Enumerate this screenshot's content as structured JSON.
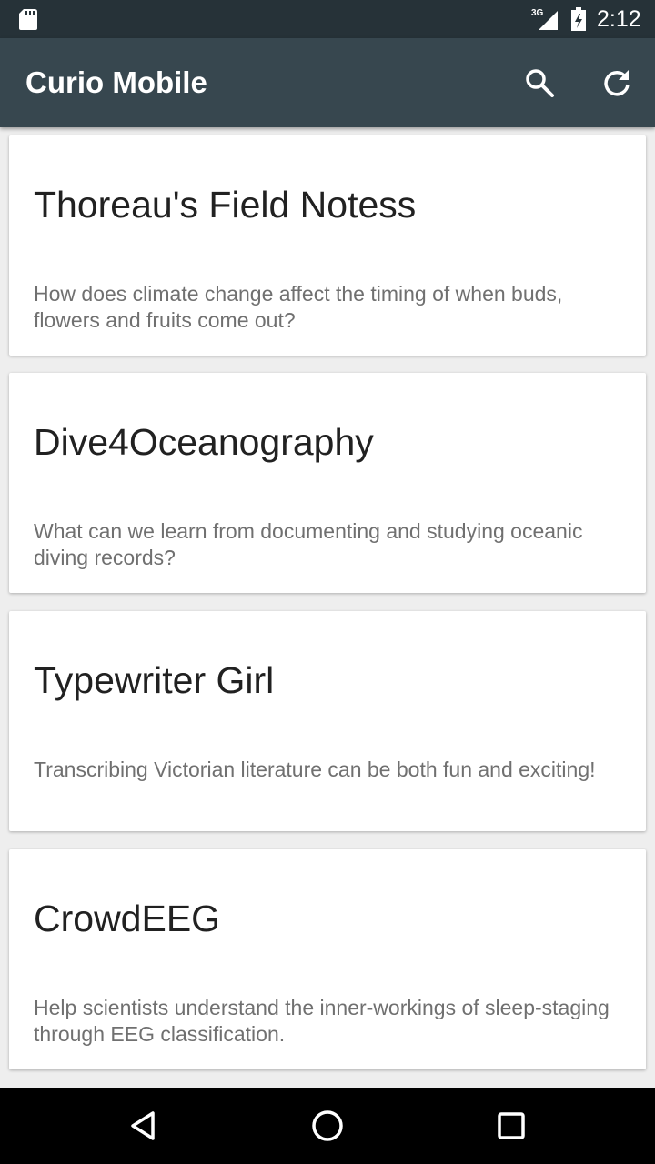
{
  "status_bar": {
    "network_label": "3G",
    "time": "2:12",
    "icons": [
      "sd-card-icon",
      "signal-3g-icon",
      "battery-charging-icon"
    ]
  },
  "app_bar": {
    "title": "Curio Mobile",
    "actions": [
      "search-icon",
      "refresh-icon"
    ],
    "background_color": "#37474f"
  },
  "projects": [
    {
      "title": "Thoreau's Field Notess",
      "description": "How does climate change affect the timing of when buds, flowers and fruits come out?"
    },
    {
      "title": "Dive4Oceanography",
      "description": "What can we learn from documenting and studying oceanic diving records?"
    },
    {
      "title": "Typewriter Girl",
      "description": "Transcribing Victorian literature can be both fun and exciting!"
    },
    {
      "title": "CrowdEEG",
      "description": "Help scientists understand the inner-workings of sleep-staging through EEG classification."
    }
  ],
  "nav_bar": {
    "buttons": [
      "back-icon",
      "home-icon",
      "recents-icon"
    ]
  }
}
